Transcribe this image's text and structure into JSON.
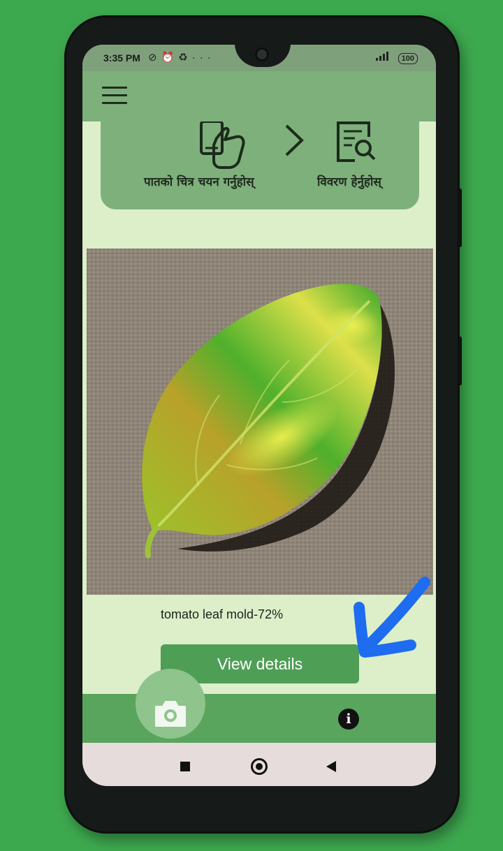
{
  "status_bar": {
    "time": "3:35 PM",
    "left_icons": [
      "silent-icon",
      "alarm-icon",
      "sync-icon",
      "more-icon"
    ],
    "right_icons": [
      "signal-icon"
    ],
    "battery": "100"
  },
  "app_bar": {
    "menu_icon": "hamburger-menu-icon"
  },
  "steps": {
    "step1_label": "पातको चित्र चयन गर्नुहोस्",
    "step2_label": "विवरण हेर्नुहोस्",
    "step1_icon": "phone-tap-icon",
    "step2_icon": "document-search-icon",
    "separator_icon": "chevron-right-icon"
  },
  "result": {
    "text": "tomato leaf mold-72%"
  },
  "buttons": {
    "view_details": "View details"
  },
  "bottom_nav": {
    "camera_icon": "camera-icon",
    "info_icon": "info-icon",
    "info_glyph": "i"
  },
  "colors": {
    "app_green": "#7eb07b",
    "nav_green": "#59a55e",
    "button_green": "#4f9e56",
    "screen_bg": "#dcefc9",
    "annotation_arrow": "#1e6cf0"
  }
}
